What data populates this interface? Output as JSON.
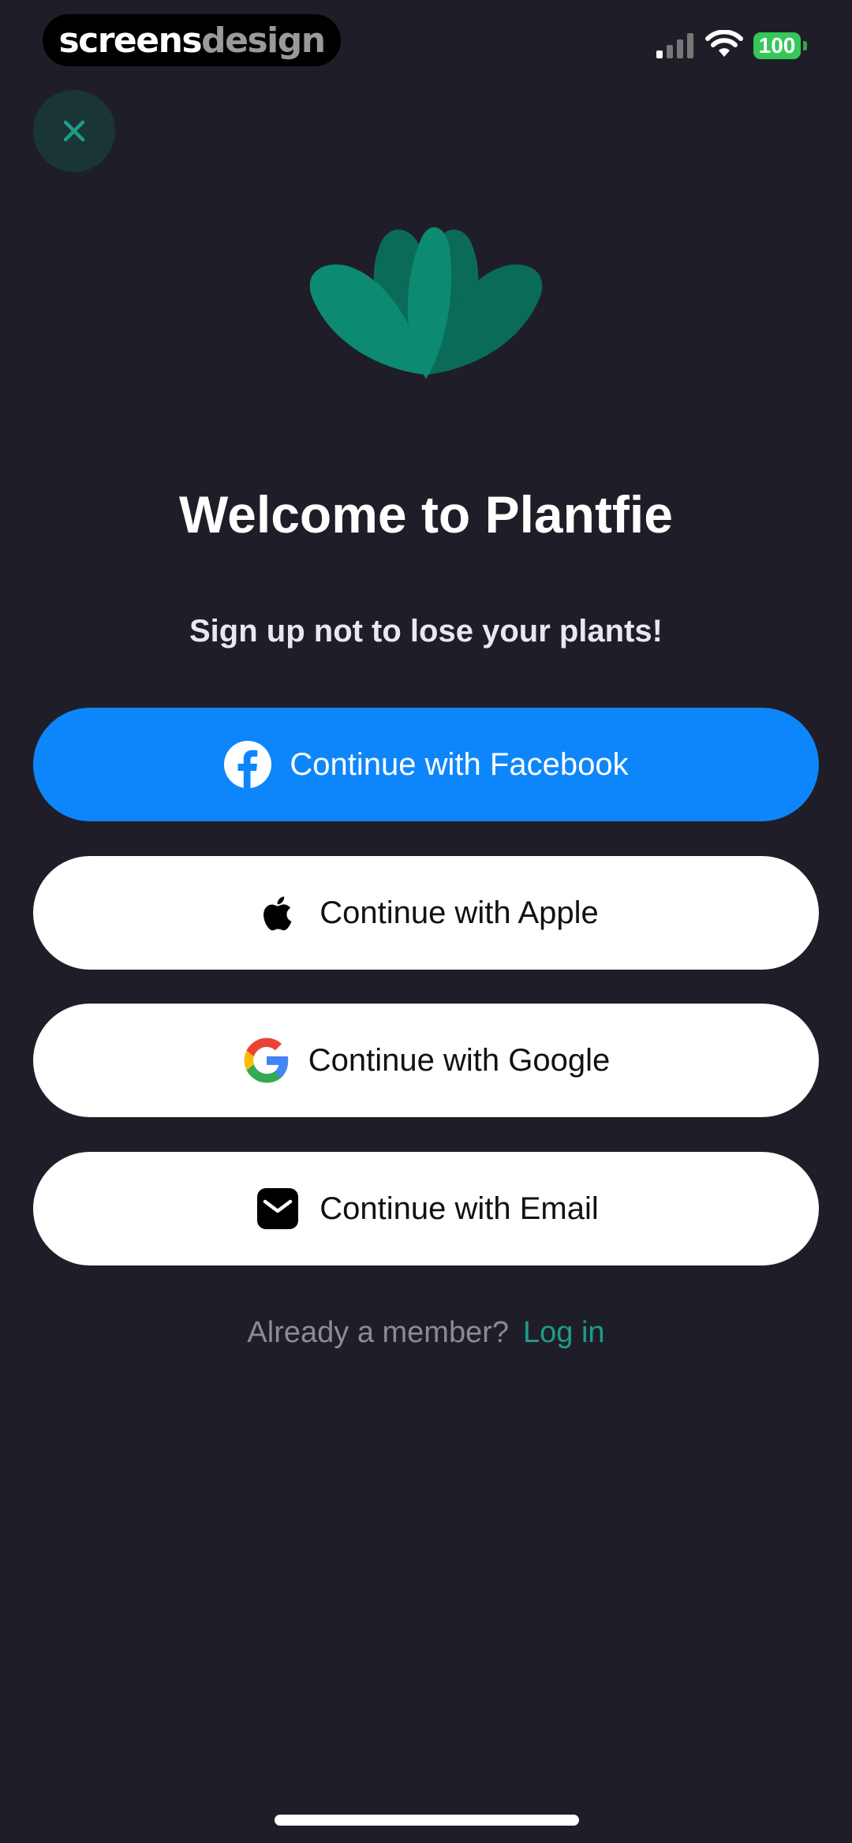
{
  "status_bar": {
    "brand_part1": "screens",
    "brand_part2": "design",
    "battery_level": "100"
  },
  "close": {
    "icon": "close-icon"
  },
  "logo": {
    "icon": "plant-leaves-logo",
    "colors": [
      "#0c8b72",
      "#0a6b58"
    ]
  },
  "title": "Welcome to Plantfie",
  "subtitle": "Sign up not to lose your plants!",
  "buttons": {
    "facebook": "Continue with Facebook",
    "apple": "Continue with Apple",
    "google": "Continue with Google",
    "email": "Continue with Email"
  },
  "footer": {
    "question": "Already a member?",
    "login": "Log in"
  },
  "colors": {
    "background": "#1f1e28",
    "facebook": "#0e86fb",
    "accent": "#1e9c8a"
  }
}
